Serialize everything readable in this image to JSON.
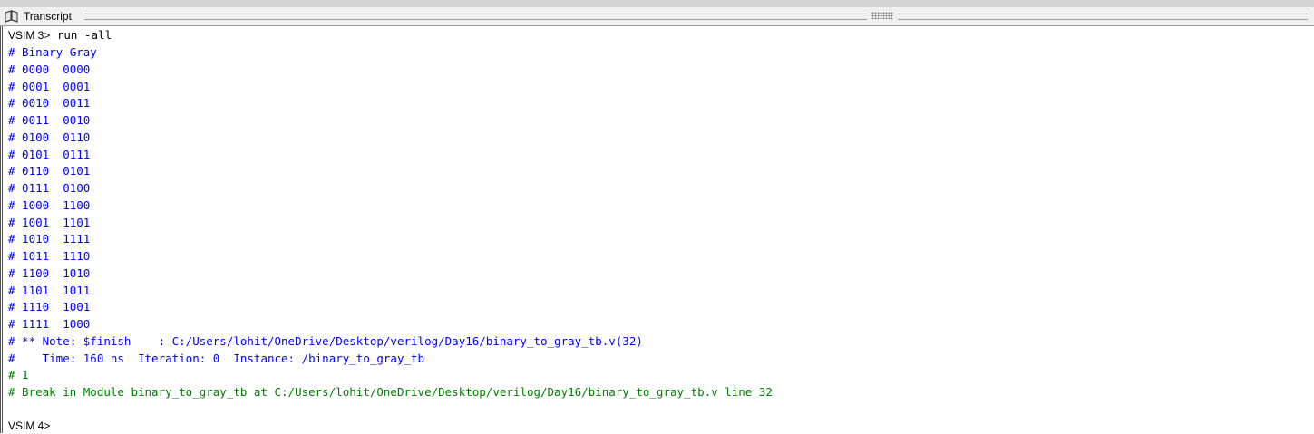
{
  "window": {
    "title": "Transcript",
    "icon": "transcript-book-icon"
  },
  "transcript": {
    "prompt1": "VSIM 3>",
    "command1": " run -all",
    "header": "# Binary Gray",
    "rows": [
      "# 0000  0000",
      "# 0001  0001",
      "# 0010  0011",
      "# 0011  0010",
      "# 0100  0110",
      "# 0101  0111",
      "# 0110  0101",
      "# 0111  0100",
      "# 1000  1100",
      "# 1001  1101",
      "# 1010  1111",
      "# 1011  1110",
      "# 1100  1010",
      "# 1101  1011",
      "# 1110  1001",
      "# 1111  1000"
    ],
    "note": "# ** Note: $finish    : C:/Users/lohit/OneDrive/Desktop/verilog/Day16/binary_to_gray_tb.v(32)",
    "note_detail": "#    Time: 160 ns  Iteration: 0  Instance: /binary_to_gray_tb",
    "result": "# 1",
    "break_msg": "# Break in Module binary_to_gray_tb at C:/Users/lohit/OneDrive/Desktop/verilog/Day16/binary_to_gray_tb.v line 32",
    "prompt2": "VSIM 4>"
  },
  "colors": {
    "output_blue": "#0000ff",
    "output_green": "#008000",
    "command_black": "#000000"
  }
}
